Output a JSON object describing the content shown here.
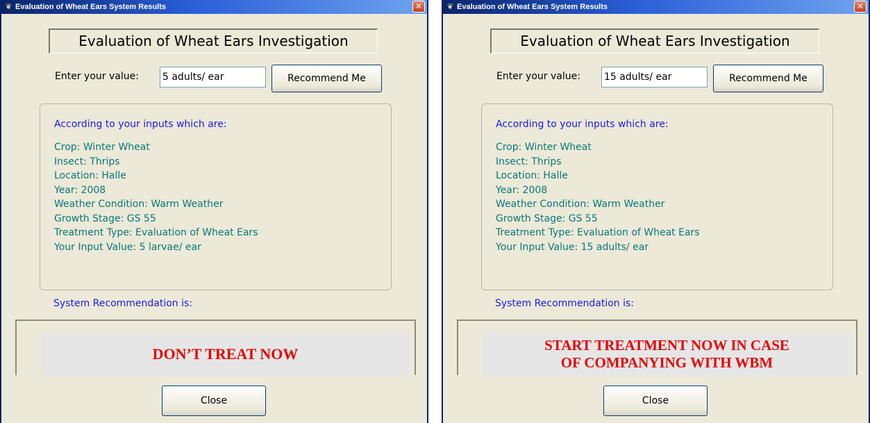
{
  "windows": [
    {
      "title": "Evaluation of Wheat Ears System Results",
      "title_icon": "wheat-icon",
      "close_glyph": "✕",
      "heading": "Evaluation of Wheat Ears Investigation",
      "enter_label": "Enter your value:",
      "input_value": "5 adults/ ear",
      "recommend_label": "Recommend Me",
      "info_intro": "According to your inputs which are:",
      "info_lines": [
        "Crop: Winter Wheat",
        "Insect: Thrips",
        "Location: Halle",
        "Year: 2008",
        "Weather Condition: Warm Weather",
        "Growth Stage: GS 55",
        "Treatment Type: Evaluation of Wheat Ears",
        "Your Input Value: 5 larvae/ ear"
      ],
      "sysrec_label": "System Recommendation is:",
      "recommendation": "DON’T TREAT NOW",
      "close_label": "Close"
    },
    {
      "title": "Evaluation of Wheat Ears System Results",
      "title_icon": "wheat-icon",
      "close_glyph": "✕",
      "heading": "Evaluation of Wheat Ears Investigation",
      "enter_label": "Enter your value:",
      "input_value": "15 adults/ ear",
      "recommend_label": "Recommend Me",
      "info_intro": "According to your inputs which are:",
      "info_lines": [
        "Crop: Winter Wheat",
        "Insect: Thrips",
        "Location: Halle",
        "Year: 2008",
        "Weather Condition: Warm Weather",
        "Growth Stage: GS 55",
        "Treatment Type: Evaluation of Wheat Ears",
        "Your Input Value: 15 adults/ ear"
      ],
      "sysrec_label": "System Recommendation is:",
      "recommendation_lines": [
        "START TREATMENT NOW IN CASE",
        "OF COMPANYING WITH WBM"
      ],
      "close_label": "Close"
    }
  ],
  "colors": {
    "titlebar": "#0a246a",
    "dialog_bg": "#ece9d8",
    "info_text": "#087878",
    "label_blue": "#1a1ae6",
    "recommendation_red": "#e60000"
  }
}
